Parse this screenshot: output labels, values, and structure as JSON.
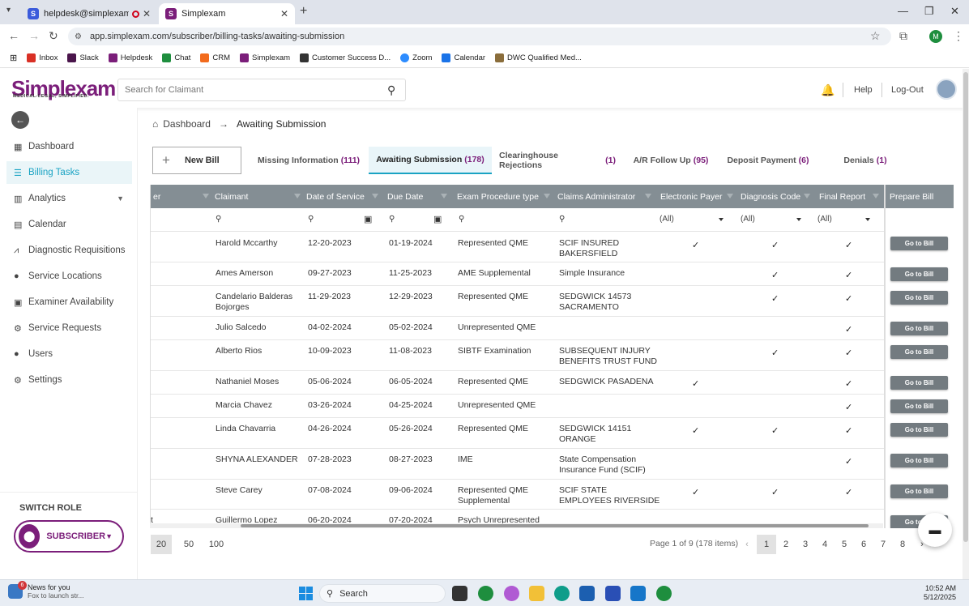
{
  "browser": {
    "tabs": [
      {
        "title": "helpdesk@simplexam.com",
        "favicon": "S"
      },
      {
        "title": "Simplexam",
        "favicon": "S"
      }
    ],
    "url": "app.simplexam.com/subscriber/billing-tasks/awaiting-submission",
    "profile_initial": "M",
    "bookmarks": [
      "Inbox",
      "Slack",
      "Helpdesk",
      "Chat",
      "CRM",
      "Simplexam",
      "Customer Success D...",
      "Zoom",
      "Calendar",
      "DWC Qualified Med..."
    ]
  },
  "header": {
    "logo": "Simplexam",
    "tagline": "MEDICAL-LEGAL, SIMPLIFIED.",
    "search_placeholder": "Search for Claimant",
    "help": "Help",
    "logout": "Log-Out"
  },
  "sidebar": {
    "items": [
      {
        "label": "Dashboard",
        "icon": "dashboard-icon"
      },
      {
        "label": "Billing Tasks",
        "icon": "billing-icon"
      },
      {
        "label": "Analytics",
        "icon": "analytics-icon"
      },
      {
        "label": "Calendar",
        "icon": "calendar-icon"
      },
      {
        "label": "Diagnostic Requisitions",
        "icon": "chart-icon"
      },
      {
        "label": "Service Locations",
        "icon": "location-icon"
      },
      {
        "label": "Examiner Availability",
        "icon": "availability-icon"
      },
      {
        "label": "Service Requests",
        "icon": "requests-icon"
      },
      {
        "label": "Users",
        "icon": "user-icon"
      },
      {
        "label": "Settings",
        "icon": "gear-icon"
      }
    ],
    "switch_role_label": "SWITCH ROLE",
    "role": "SUBSCRIBER"
  },
  "breadcrumb": {
    "home": "Dashboard",
    "current": "Awaiting Submission"
  },
  "tasks": {
    "new_bill": "New Bill",
    "tabs": [
      {
        "label": "Missing Information",
        "count": "(111)"
      },
      {
        "label": "Awaiting Submission",
        "count": "(178)"
      },
      {
        "label": "Clearinghouse Rejections",
        "count": "(1)"
      },
      {
        "label": "A/R Follow Up",
        "count": "(95)"
      },
      {
        "label": "Deposit Payment",
        "count": "(6)"
      },
      {
        "label": "Denials",
        "count": "(1)"
      }
    ]
  },
  "grid": {
    "columns": [
      "er",
      "Claimant",
      "Date of Service",
      "Due Date",
      "Exam Procedure type",
      "Claims Administrator",
      "Electronic Payer",
      "Diagnosis Code",
      "Final Report",
      "Prepare Bill"
    ],
    "filter_all": "(All)",
    "goto_label": "Go to Bill",
    "check": "✓",
    "rows": [
      {
        "lead": "",
        "claimant": "Harold Mccarthy",
        "dos": "12-20-2023",
        "due": "01-19-2024",
        "exam": "Represented QME",
        "admin": "SCIF INSURED BAKERSFIELD",
        "ep": true,
        "dx": true,
        "fr": true
      },
      {
        "lead": "",
        "claimant": "Ames Amerson",
        "dos": "09-27-2023",
        "due": "11-25-2023",
        "exam": "AME Supplemental",
        "admin": "Simple Insurance",
        "ep": false,
        "dx": true,
        "fr": true
      },
      {
        "lead": "",
        "claimant": "Candelario Balderas Bojorges",
        "dos": "11-29-2023",
        "due": "12-29-2023",
        "exam": "Represented QME",
        "admin": "SEDGWICK 14573 SACRAMENTO",
        "ep": false,
        "dx": true,
        "fr": true
      },
      {
        "lead": "",
        "claimant": "Julio Salcedo",
        "dos": "04-02-2024",
        "due": "05-02-2024",
        "exam": "Unrepresented QME",
        "admin": "",
        "ep": false,
        "dx": false,
        "fr": true
      },
      {
        "lead": "",
        "claimant": "Alberto Rios",
        "dos": "10-09-2023",
        "due": "11-08-2023",
        "exam": "SIBTF Examination",
        "admin": "SUBSEQUENT INJURY BENEFITS TRUST FUND",
        "ep": false,
        "dx": true,
        "fr": true
      },
      {
        "lead": "",
        "claimant": "Nathaniel Moses",
        "dos": "05-06-2024",
        "due": "06-05-2024",
        "exam": "Represented QME",
        "admin": "SEDGWICK PASADENA",
        "ep": true,
        "dx": false,
        "fr": true
      },
      {
        "lead": "",
        "claimant": "Marcia Chavez",
        "dos": "03-26-2024",
        "due": "04-25-2024",
        "exam": "Unrepresented QME",
        "admin": "",
        "ep": false,
        "dx": false,
        "fr": true
      },
      {
        "lead": "",
        "claimant": "Linda Chavarria",
        "dos": "04-26-2024",
        "due": "05-26-2024",
        "exam": "Represented QME",
        "admin": "SEDGWICK 14151 ORANGE",
        "ep": true,
        "dx": true,
        "fr": true
      },
      {
        "lead": "",
        "claimant": "SHYNA ALEXANDER",
        "dos": "07-28-2023",
        "due": "08-27-2023",
        "exam": "IME",
        "admin": "State Compensation Insurance Fund (SCIF)",
        "ep": false,
        "dx": false,
        "fr": true
      },
      {
        "lead": "",
        "claimant": "Steve Carey",
        "dos": "07-08-2024",
        "due": "09-06-2024",
        "exam": "Represented QME Supplemental",
        "admin": "SCIF STATE EMPLOYEES RIVERSIDE",
        "ep": true,
        "dx": true,
        "fr": true
      },
      {
        "lead": "t",
        "claimant": "Guillermo Lopez",
        "dos": "06-20-2024",
        "due": "07-20-2024",
        "exam": "Psych Unrepresented",
        "admin": "",
        "ep": false,
        "dx": false,
        "fr": false
      }
    ]
  },
  "pager": {
    "sizes": [
      "20",
      "50",
      "100"
    ],
    "info": "Page 1 of 9 (178 items)",
    "pages": [
      "1",
      "2",
      "3",
      "4",
      "5",
      "6",
      "7",
      "8"
    ]
  },
  "taskbar": {
    "news_title": "News for you",
    "news_sub": "Fox to launch str...",
    "news_badge": "6",
    "search": "Search",
    "time": "10:52 AM",
    "date": "5/12/2025"
  }
}
